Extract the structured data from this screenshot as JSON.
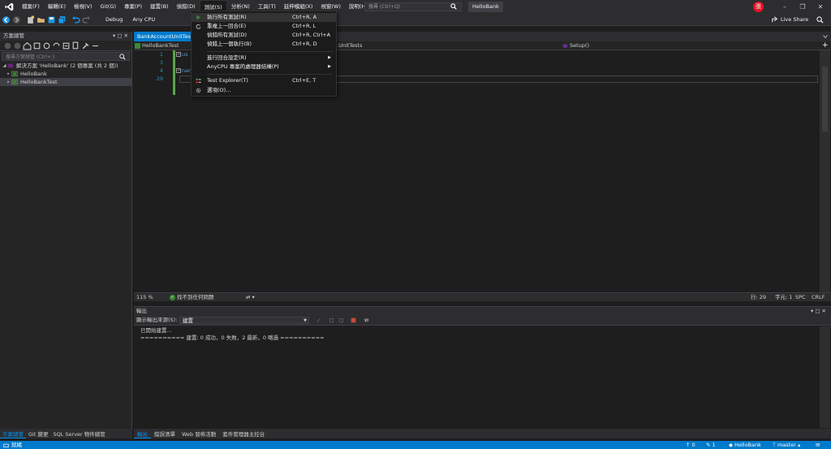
{
  "titlebar": {
    "menus": [
      "檔案(F)",
      "編輯(E)",
      "檢視(V)",
      "Git(G)",
      "專案(P)",
      "建置(B)",
      "偵錯(D)",
      "測試(S)",
      "分析(N)",
      "工具(T)",
      "延伸模組(X)",
      "視窗(W)",
      "說明(H)"
    ],
    "search_placeholder": "搜尋 (Ctrl+Q)",
    "app_name": "HelloBank",
    "avatar_letter": "張",
    "live_share": "Live Share"
  },
  "toolbar": {
    "config": "Debug",
    "platform": "Any CPU"
  },
  "solution_explorer": {
    "title": "方案總管",
    "search_placeholder": "搜尋方案總管 (Ctrl+;)",
    "tree": [
      {
        "label": "解決方案 'HelloBank' (2 個專案 (共 2 個))",
        "level": 0
      },
      {
        "label": "HelloBank",
        "level": 1
      },
      {
        "label": "HelloBankTest",
        "level": 1
      }
    ]
  },
  "left_tabs": [
    "方案總管",
    "Git 變更",
    "SQL Server 物件總管"
  ],
  "editor": {
    "file_tab": "BankAccountUnitTest.c",
    "nav_project": "HelloBankTest",
    "nav_class": ".UnitTests",
    "nav_member": "Setup()",
    "line_numbers": [
      "1",
      "3",
      "4",
      "29"
    ],
    "code_lines": [
      "us",
      "",
      "nam",
      ""
    ],
    "zoom": "115 %",
    "issues": "找不到任何問題",
    "line_info": "行: 29",
    "char_info": "字元: 1",
    "spc": "SPC",
    "crlf": "CRLF"
  },
  "output": {
    "title": "輸出",
    "source_label": "顯示輸出來源(S):",
    "source_value": "建置",
    "lines": [
      "已開始建置...",
      "========== 建置: 0 成功，0 失敗，2 最新，0 略過 =========="
    ]
  },
  "bottom_tabs": [
    "輸出",
    "錯誤清單",
    "Web 發佈活動",
    "套件管理器主控台"
  ],
  "statusbar": {
    "ready": "就緒",
    "up_count": "0",
    "edit_count": "1",
    "repo": "HelloBank",
    "branch": "master"
  },
  "test_menu": {
    "items": [
      {
        "label": "執行所有測試(R)",
        "shortcut": "Ctrl+R, A",
        "icon": "play-icon"
      },
      {
        "label": "重複上一回合(E)",
        "shortcut": "Ctrl+R, L",
        "icon": "repeat-icon"
      },
      {
        "label": "偵錯所有測試(D)",
        "shortcut": "Ctrl+R, Ctrl+A",
        "icon": ""
      },
      {
        "label": "偵錯上一個執行(B)",
        "shortcut": "Ctrl+R, D",
        "icon": ""
      },
      {
        "label": "進行回合設定(R)",
        "shortcut": "",
        "icon": ""
      },
      {
        "label": "AnyCPU 專案的處理器結構(P)",
        "shortcut": "",
        "icon": ""
      },
      {
        "label": "Test Explorer(T)",
        "shortcut": "Ctrl+E, T",
        "icon": "test-explorer-icon"
      },
      {
        "label": "選項(O)...",
        "shortcut": "",
        "icon": "gear-icon"
      }
    ]
  },
  "colors": {
    "accent": "#007acc",
    "background": "#1e1e1e",
    "panel": "#252526",
    "chrome": "#2d2d30",
    "coverage_green": "#57a64a"
  }
}
